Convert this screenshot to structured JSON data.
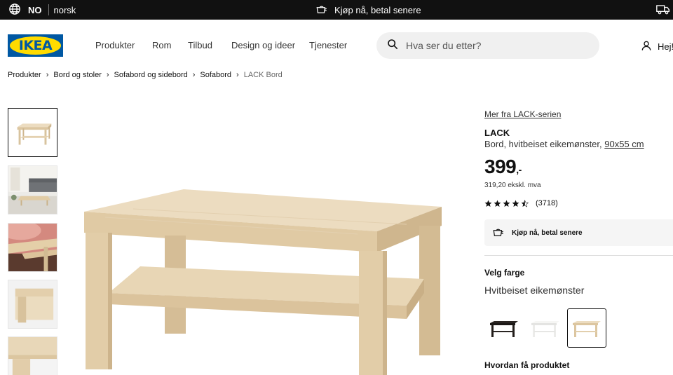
{
  "topbar": {
    "language_code": "NO",
    "language_name": "norsk",
    "promo": "Kjøp nå, betal senere",
    "icons": [
      "globe-icon",
      "shopping-bag-icon",
      "truck-icon"
    ]
  },
  "header": {
    "logo": "IKEA",
    "nav": [
      "Produkter",
      "Rom",
      "Tilbud",
      "Design og ideer",
      "Tjenester"
    ],
    "search_placeholder": "Hva ser du etter?",
    "account_label": "Hej!"
  },
  "breadcrumb": {
    "items": [
      "Produkter",
      "Bord og stoler",
      "Sofabord og sidebord",
      "Sofabord"
    ],
    "current": "LACK Bord"
  },
  "product": {
    "series_link": "Mer fra LACK-serien",
    "name": "LACK",
    "description": "Bord, hvitbeiset eikemønster,",
    "dimensions": "90x55 cm",
    "price": "399",
    "price_suffix": ",-",
    "price_ex_vat": "319,20 ekskl. mva",
    "rating_value": 4.5,
    "rating_count": "(3718)",
    "payment_option": "Kjøp nå, betal senere",
    "color_heading": "Velg farge",
    "selected_color": "Hvitbeiset eikemønster",
    "swatches": [
      "black-brown",
      "white",
      "white-stained-oak"
    ],
    "delivery_heading": "Hvordan få produktet"
  },
  "colors": {
    "topbar_bg": "#111111",
    "ikea_blue": "#0058a3",
    "ikea_yellow": "#ffdb00",
    "search_bg": "#f0f0f0",
    "oak": "#e2cfad"
  }
}
